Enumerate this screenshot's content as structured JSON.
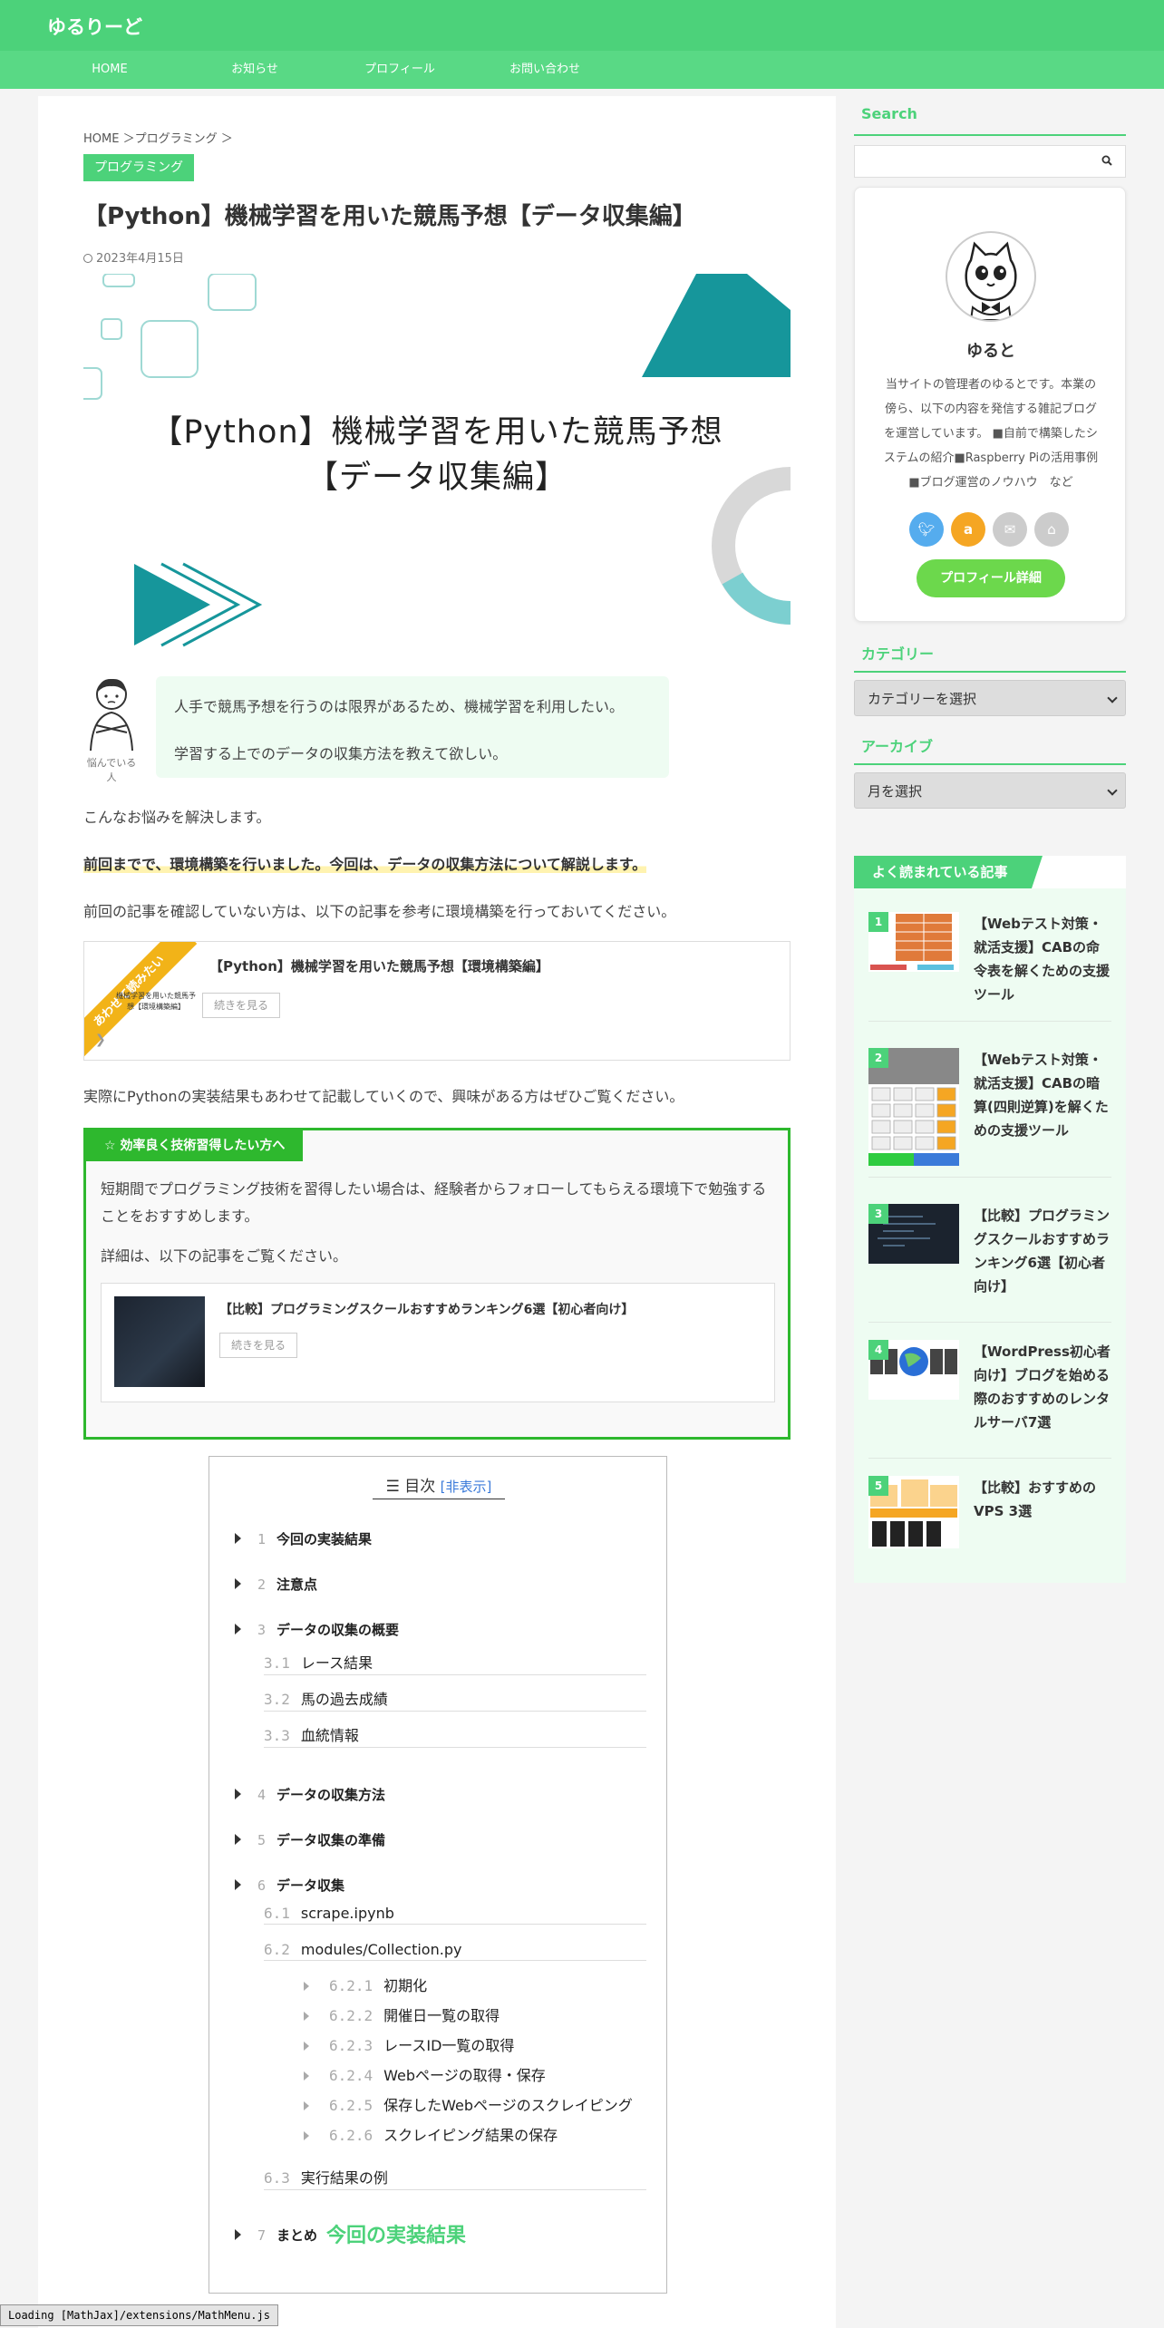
{
  "site": {
    "title": "ゆるりーど"
  },
  "nav": {
    "items": [
      "HOME",
      "お知らせ",
      "プロフィール",
      "お問い合わせ"
    ]
  },
  "breadcrumb": "HOME ＞プログラミング ＞",
  "category_badge": "プログラミング",
  "post": {
    "title": "【Python】機械学習を用いた競馬予想【データ収集編】",
    "date": "2023年4月15日",
    "eyecatch_line1": "【Python】機械学習を用いた競馬予想",
    "eyecatch_line2": "【データ収集編】"
  },
  "worry": {
    "caption": "悩んでいる人",
    "line1": "人手で競馬予想を行うのは限界があるため、機械学習を利用したい。",
    "line2": "学習する上でのデータの収集方法を教えて欲しい。"
  },
  "paragraphs": {
    "p1": "こんなお悩みを解決します。",
    "p2": "前回までで、環境構築を行いました。今回は、データの収集方法について解説します。",
    "p3": "前回の記事を確認していない方は、以下の記事を参考に環境構築を行っておいてください。",
    "p4": "実際にPythonの実装結果もあわせて記載していくので、興味がある方はぜひご覧ください。"
  },
  "blogcard": {
    "ribbon": "あわせて読みたい",
    "thumb_text": "機械学習を用いた競馬予想【環境構築編】",
    "title": "【Python】機械学習を用いた競馬予想【環境構築編】",
    "more": "続きを見る"
  },
  "infobox": {
    "head": "効率良く技術習得したい方へ",
    "text1": "短期間でプログラミング技術を習得したい場合は、経験者からフォローしてもらえる環境下で勉強することをおすすめします。",
    "text2": "詳細は、以下の記事をご覧ください。",
    "card_title": "【比較】プログラミングスクールおすすめランキング6選【初心者向け】",
    "card_more": "続きを見る"
  },
  "toc": {
    "title": "目次",
    "hide": "非表示",
    "items": [
      {
        "num": "1",
        "label": "今回の実装結果"
      },
      {
        "num": "2",
        "label": "注意点"
      },
      {
        "num": "3",
        "label": "データの収集の概要"
      },
      {
        "num": "3.1",
        "label": "レース結果"
      },
      {
        "num": "3.2",
        "label": "馬の過去成績"
      },
      {
        "num": "3.3",
        "label": "血統情報"
      },
      {
        "num": "4",
        "label": "データの収集方法"
      },
      {
        "num": "5",
        "label": "データ収集の準備"
      },
      {
        "num": "6",
        "label": "データ収集"
      },
      {
        "num": "6.1",
        "label": "scrape.ipynb"
      },
      {
        "num": "6.2",
        "label": "modules/Collection.py"
      },
      {
        "num": "6.2.1",
        "label": "初期化"
      },
      {
        "num": "6.2.2",
        "label": "開催日一覧の取得"
      },
      {
        "num": "6.2.3",
        "label": "レースID一覧の取得"
      },
      {
        "num": "6.2.4",
        "label": "Webページの取得・保存"
      },
      {
        "num": "6.2.5",
        "label": "保存したWebページのスクレイピング"
      },
      {
        "num": "6.2.6",
        "label": "スクレイピング結果の保存"
      },
      {
        "num": "6.3",
        "label": "実行結果の例"
      },
      {
        "num": "7",
        "label": "まとめ"
      }
    ]
  },
  "next_heading": "今回の実装結果",
  "sidebar": {
    "search_title": "Search",
    "profile_name": "ゆると",
    "profile_desc": "当サイトの管理者のゆるとです。本業の傍ら、以下の内容を発信する雑記ブログを運営しています。 ■自前で構築したシステムの紹介■Raspberry Piの活用事例■ブログ運営のノウハウ　など",
    "profile_button": "プロフィール詳細",
    "category_title": "カテゴリー",
    "category_select": "カテゴリーを選択",
    "archive_title": "アーカイブ",
    "archive_select": "月を選択",
    "popular_title": "よく読まれている記事",
    "popular": [
      {
        "rank": "1",
        "title": "【Webテスト対策・就活支援】CABの命令表を解くための支援ツール"
      },
      {
        "rank": "2",
        "title": "【Webテスト対策・就活支援】CABの暗算(四則逆算)を解くための支援ツール"
      },
      {
        "rank": "3",
        "title": "【比較】プログラミングスクールおすすめランキング6選【初心者向け】"
      },
      {
        "rank": "4",
        "title": "【WordPress初心者向け】ブログを始める際のおすすめのレンタルサーバ7選"
      },
      {
        "rank": "5",
        "title": "【比較】おすすめのVPS 3選"
      }
    ]
  },
  "status_bar": "Loading [MathJax]/extensions/MathMenu.js",
  "colors": {
    "brand_green": "#4cd27a",
    "info_green": "#2eb82e",
    "ribbon_yellow": "#f2b318"
  }
}
